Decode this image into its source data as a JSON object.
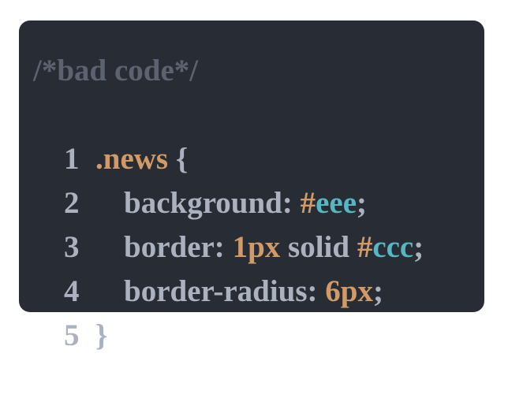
{
  "code": {
    "comment": "/*bad code*/",
    "lines": [
      {
        "number": "1",
        "selector": ".news",
        "brace": " {"
      },
      {
        "number": "2",
        "property": "background:",
        "hash": "#",
        "value": "eee",
        "semicolon": ";"
      },
      {
        "number": "3",
        "property": "border:",
        "num": "1px",
        "text": " solid ",
        "hash": "#",
        "value": "ccc",
        "semicolon": ";"
      },
      {
        "number": "4",
        "property": "border-radius:",
        "num": "6px",
        "semicolon": ";"
      },
      {
        "number": "5",
        "brace": "}"
      }
    ]
  },
  "colors": {
    "background": "#282c34",
    "comment": "#5c6370",
    "text": "#abb2bf",
    "number": "#d19a66",
    "hex": "#56b6c2"
  }
}
